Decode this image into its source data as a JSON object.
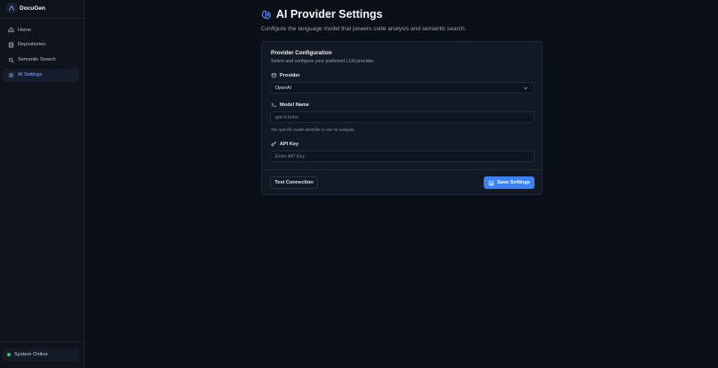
{
  "app": {
    "name": "DocuGen"
  },
  "sidebar": {
    "items": [
      {
        "label": "Home",
        "icon": "home-icon"
      },
      {
        "label": "Repositories",
        "icon": "database-icon"
      },
      {
        "label": "Semantic Search",
        "icon": "search-icon"
      },
      {
        "label": "AI Settings",
        "icon": "settings-icon",
        "active": true
      }
    ],
    "status": {
      "label": "System Online",
      "color": "#2ecc71"
    }
  },
  "page": {
    "title": "AI Provider Settings",
    "subtitle": "Configure the language model that powers code analysis and semantic search."
  },
  "card": {
    "title": "Provider Configuration",
    "description": "Select and configure your preferred LLM provider.",
    "provider": {
      "label": "Provider",
      "value": "OpenAI"
    },
    "model": {
      "label": "Model Name",
      "value": "gpt-4-turbo",
      "hint": "The specific model identifier to use for analysis."
    },
    "api_key": {
      "label": "API Key",
      "placeholder": "Enter API Key"
    },
    "test_label": "Test Connection",
    "save_label": "Save Settings"
  },
  "colors": {
    "accent": "#3b82f6",
    "active_nav_text": "#7fb2ff",
    "background": "#0b0f17"
  }
}
